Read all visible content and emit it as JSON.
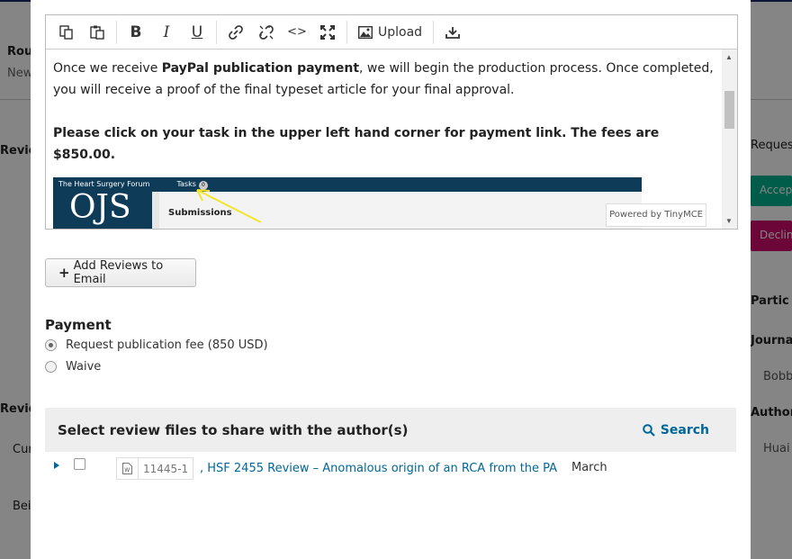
{
  "background": {
    "labels": [
      {
        "text": "Rou",
        "bold": true
      },
      {
        "text": "New",
        "bold": false
      },
      {
        "text": "Revie",
        "bold": true
      },
      {
        "text": "Revie",
        "bold": true
      },
      {
        "text": "Cur",
        "bold": false
      },
      {
        "text": "Bei",
        "bold": false
      },
      {
        "text": "Request",
        "bold": false
      },
      {
        "text": "Partic",
        "bold": true
      },
      {
        "text": "Journal",
        "bold": true
      },
      {
        "text": "Bobb",
        "bold": false
      },
      {
        "text": "Author",
        "bold": true
      },
      {
        "text": "Huai",
        "bold": false
      }
    ],
    "accept_label": "Accept S",
    "decline_label": "Decline S"
  },
  "editor": {
    "toolbar": {
      "copy_icon": "copy-icon",
      "paste_icon": "paste-icon",
      "bold_glyph": "B",
      "italic_glyph": "I",
      "underline_glyph": "U",
      "link_icon": "link-icon",
      "unlink_icon": "unlink-icon",
      "code_glyph": "<>",
      "fullscreen_icon": "fullscreen-icon",
      "upload_label": "Upload",
      "insert_icon": "insert-icon"
    },
    "paragraph1_pre": "Once we receive ",
    "paragraph1_bold": "PayPal publication payment",
    "paragraph1_post": ", we will begin the production process. Once completed, you will receive a proof of the final typeset article for your final approval.",
    "paragraph2": "Please click on your task in the upper left hand corner for payment link. The fees are $850.00.",
    "embedded": {
      "site_name": "The Heart Surgery Forum",
      "tasks_label": "Tasks",
      "tasks_count": "0",
      "logo_text": "OJS",
      "submissions_label": "Submissions"
    },
    "powered_by": "Powered by TinyMCE"
  },
  "add_reviews_label": "Add Reviews to Email",
  "payment": {
    "heading": "Payment",
    "options": [
      {
        "label": "Request publication fee (850 USD)",
        "selected": true
      },
      {
        "label": "Waive",
        "selected": false
      }
    ]
  },
  "files": {
    "heading": "Select review files to share with the author(s)",
    "search_label": "Search",
    "rows": [
      {
        "file_id": "11445-1",
        "title": ", HSF 2455 Review – Anomalous origin of an RCA from the PA",
        "date": "March",
        "checked": false
      }
    ]
  },
  "colors": {
    "link": "#006798",
    "accept": "#00b28d",
    "decline": "#d00a6c",
    "header_bg": "#0e3b57"
  }
}
